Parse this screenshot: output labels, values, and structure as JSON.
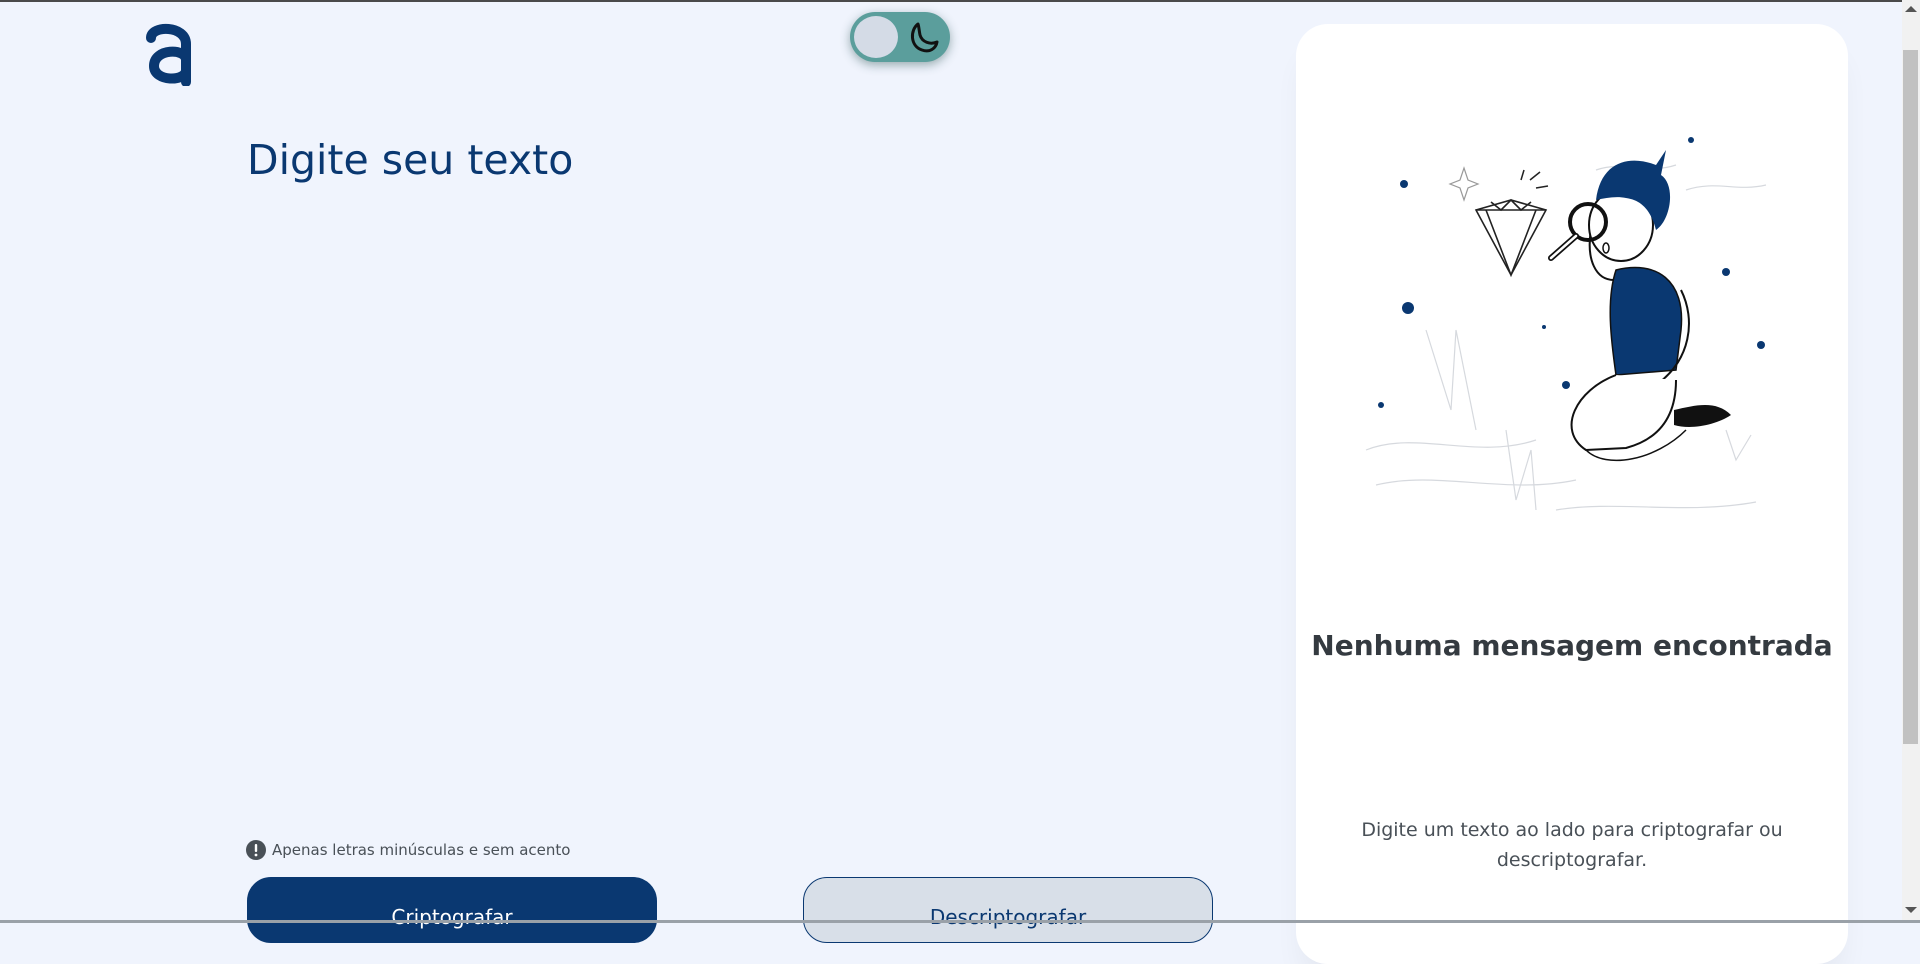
{
  "theme": {
    "primary": "#0a3871",
    "background": "#f0f4fd",
    "toggle_color": "#5b9e9c",
    "dark_mode": false
  },
  "header": {
    "logo": "a",
    "theme_toggle_icon": "moon-icon"
  },
  "input": {
    "title": "Digite seu texto",
    "value": ""
  },
  "hint": {
    "icon": "exclamation-circle-icon",
    "text": "Apenas letras minúsculas e sem acento"
  },
  "buttons": {
    "encrypt_label": "Criptografar",
    "decrypt_label": "Descriptografar"
  },
  "output": {
    "illustration": "person-with-magnifying-glass-illustration",
    "empty_title": "Nenhuma mensagem encontrada",
    "empty_desc": "Digite um texto ao lado para criptografar ou descriptografar."
  }
}
